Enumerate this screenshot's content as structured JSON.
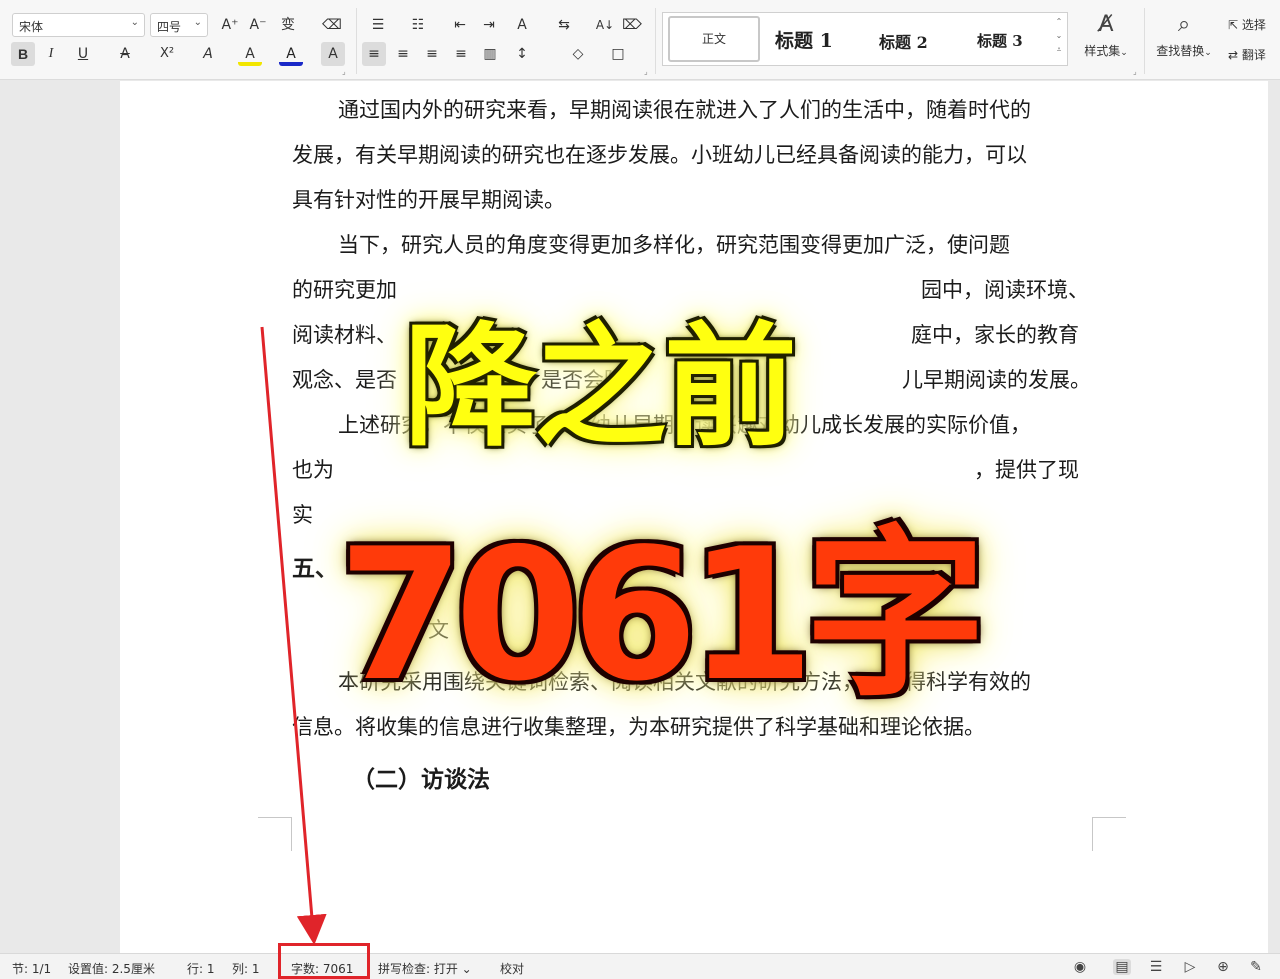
{
  "ribbon": {
    "font_name": "宋体",
    "font_size": "四号",
    "icons": {
      "grow_font": "A⁺",
      "shrink_font": "A⁻",
      "phonetic": "变",
      "clear_format": "⌫",
      "bullets": "☰",
      "numbering": "☷",
      "outdent": "⇤",
      "indent": "⇥",
      "char_scale": "A",
      "sort_dir": "⇆",
      "sort": "A↓",
      "para_mark": "⌦",
      "bold": "B",
      "italic": "I",
      "underline": "U",
      "strike": "A",
      "superscript": "X²",
      "text_effect": "A",
      "highlight": "A",
      "font_color": "A",
      "char_shade": "A",
      "align_left": "≡",
      "align_center": "≡",
      "align_right": "≡",
      "justify": "≡",
      "distribute": "▥",
      "line_spacing": "↕",
      "shading": "◇",
      "borders": "□"
    },
    "styles": {
      "normal": "正文",
      "h1": "标题 1",
      "h2": "标题 2",
      "h3": "标题 3"
    },
    "style_set_label": "样式集",
    "find_replace_label": "查找替换",
    "select_label": "选择",
    "translate_label": "翻译",
    "colors": {
      "highlight": "#f2e600",
      "font_color": "#d20000"
    }
  },
  "document": {
    "lines": [
      "通过国内外的研究来看，早期阅读很在就进入了人们的生活中，随着时代的",
      "发展，有关早期阅读的研究也在逐步发展。小班幼儿已经具备阅读的能力，可以",
      "具有针对性的开展早期阅读。",
      "当下，研究人员的角度变得更加多样化，研究范围变得更加广泛，使问题",
      "的研究更加",
      "园中，阅读环境、",
      "阅读材料、",
      "庭中，家长的教育",
      "观念、是否",
      "，是否会陪",
      "儿早期阅读的发展。",
      "上述研究，不仅证实了小班幼儿早期阅读兴趣对幼儿成长发展的实际价值，",
      "也为",
      "，提供了现",
      "实",
      "五、",
      "文",
      "法",
      "本研究采用围绕关键词检索、阅读相关文献的研究方法，以获得科学有效的",
      "信息。将收集的信息进行收集整理，为本研究提供了科学基础和理论依据。",
      "（二）访谈法"
    ]
  },
  "overlay": {
    "line1": "降之前",
    "line2": "7061字"
  },
  "statusbar": {
    "section": "节: 1/1",
    "setting": "设置值: 2.5厘米",
    "row": "行: 1",
    "col": "列: 1",
    "word_count": "字数: 7061",
    "spell_check": "拼写检查: 打开",
    "proofread": "校对"
  },
  "annotation": {
    "color": "#e0242a"
  }
}
